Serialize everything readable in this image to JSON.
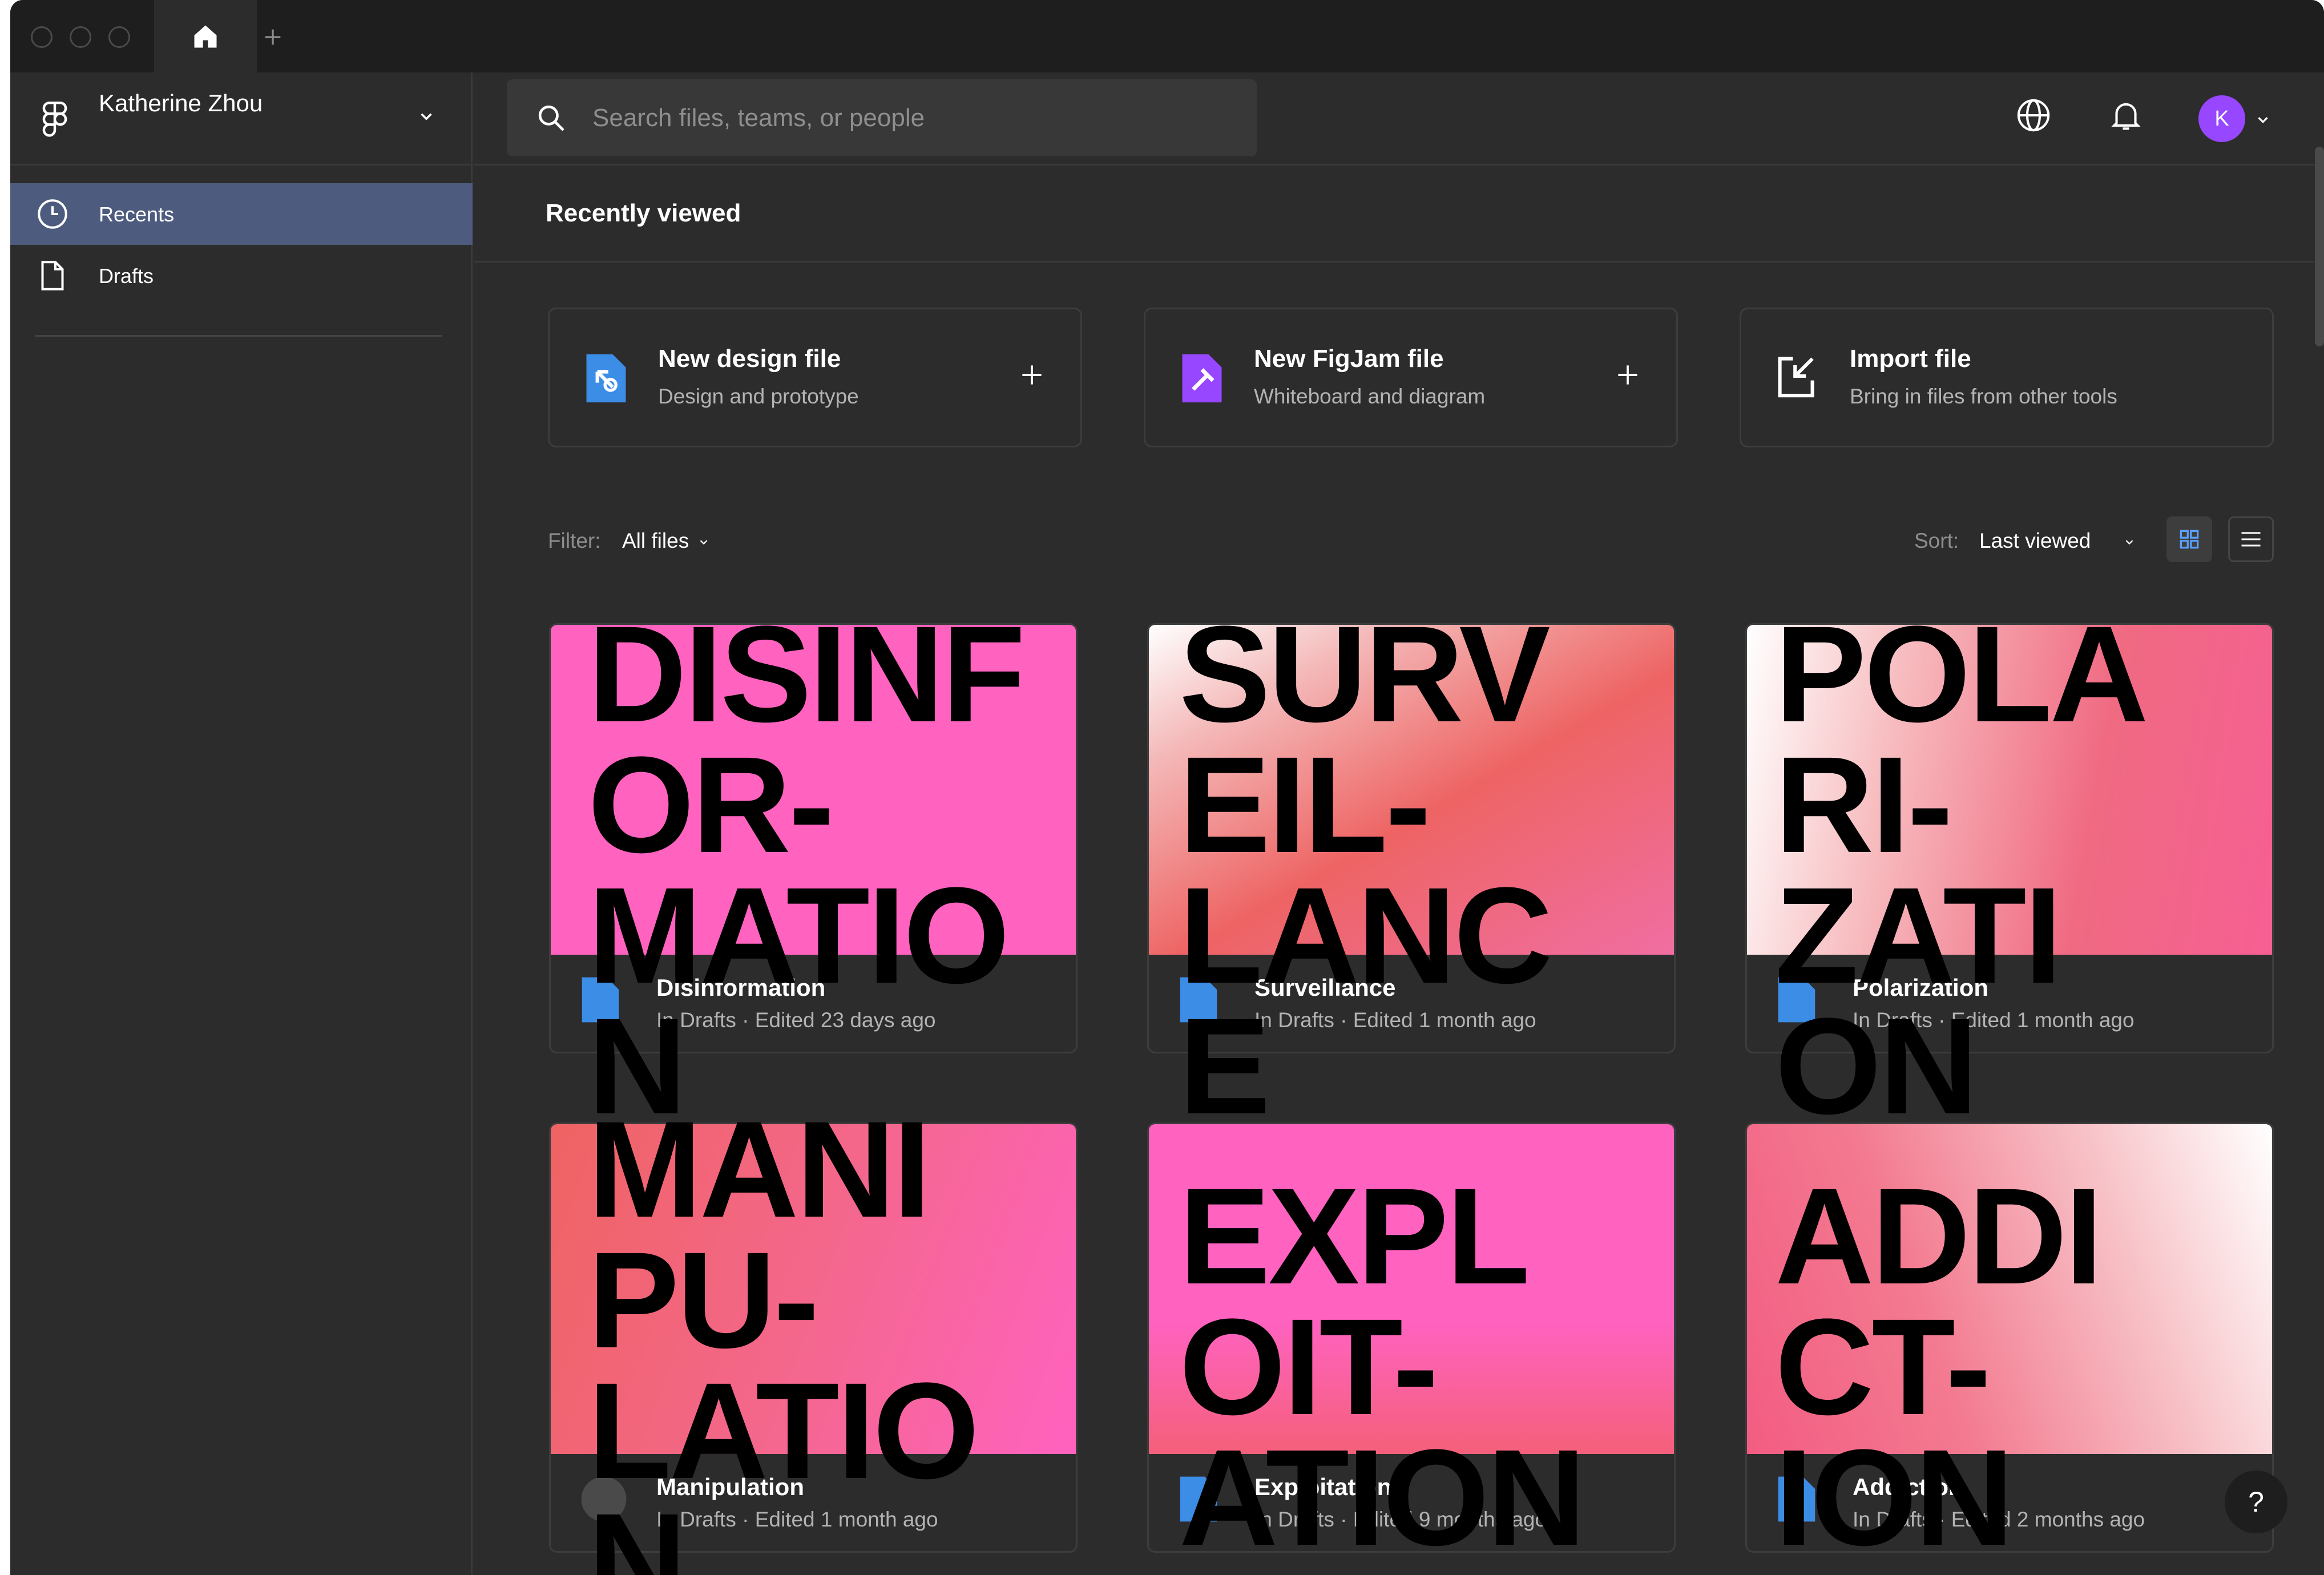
{
  "sidebar": {
    "account_name": "Katherine Zhou",
    "items": [
      {
        "label": "Recents",
        "icon": "clock-icon",
        "active": true
      },
      {
        "label": "Drafts",
        "icon": "file-icon",
        "active": false
      }
    ]
  },
  "search": {
    "placeholder": "Search files, teams, or people"
  },
  "header": {
    "avatar_initial": "K"
  },
  "main": {
    "section_title": "Recently viewed",
    "actions": [
      {
        "title": "New design file",
        "subtitle": "Design and prototype",
        "icon": "design-file-icon"
      },
      {
        "title": "New FigJam file",
        "subtitle": "Whiteboard and diagram",
        "icon": "figjam-file-icon"
      },
      {
        "title": "Import file",
        "subtitle": "Bring in files from other tools",
        "icon": "import-icon"
      }
    ],
    "filter": {
      "label": "Filter:",
      "value": "All files"
    },
    "sort": {
      "label": "Sort:",
      "value": "Last viewed"
    },
    "files": [
      {
        "name": "Disinformation",
        "meta": "In Drafts · Edited 23 days ago",
        "overlay": "DISINF\nOR-\nMATIO\nN"
      },
      {
        "name": "Surveillance",
        "meta": "In Drafts · Edited 1 month ago",
        "overlay": "SURV\nEIL-\nLANC\nE"
      },
      {
        "name": "Polarization",
        "meta": "In Drafts · Edited 1 month ago",
        "overlay": "POLA\nRI-\nZATI\nON"
      },
      {
        "name": "Manipulation",
        "meta": "In Drafts · Edited 1 month ago",
        "overlay": "MANI\nPU-\nLATIO\nN"
      },
      {
        "name": "Exploitation",
        "meta": "In Drafts · Edited 9 months ago",
        "overlay": "EXPL\nOIT-\nATION"
      },
      {
        "name": "Addiction",
        "meta": "In Drafts · Edited 2 months ago",
        "overlay": "ADDI\nCT-\nION"
      }
    ]
  },
  "help_label": "?",
  "colors": {
    "window_bg": "#2c2c2c",
    "titlebar_bg": "#1e1e1e",
    "active_nav": "#4d5b7e",
    "avatar": "#9747ff",
    "design_icon": "#3c8de6",
    "figjam_icon": "#9747ff",
    "thumb_pink": "#ff62bf"
  }
}
